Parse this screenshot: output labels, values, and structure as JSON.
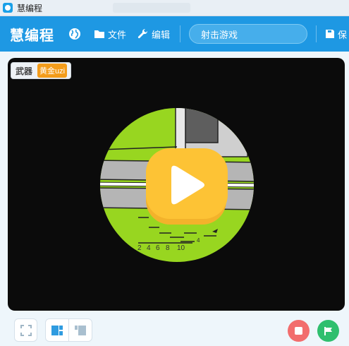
{
  "window": {
    "title": "慧编程"
  },
  "header": {
    "logo": "慧编程",
    "file_label": "文件",
    "edit_label": "编辑",
    "project_name": "射击游戏",
    "save_label": "保"
  },
  "stage": {
    "variable": {
      "name": "武器",
      "value": "黄金uzi"
    },
    "scope_marks": [
      "2",
      "4",
      "6",
      "8",
      "10",
      "4"
    ]
  },
  "colors": {
    "header": "#1e98e3",
    "accent_orange": "#f39c1a",
    "scope_green": "#98d620",
    "play_yellow": "#fdc335",
    "stop_red": "#f26d6d",
    "go_green": "#2fbf6e"
  },
  "icons": {
    "app": "mblock-icon",
    "language": "globe-icon",
    "file": "folder-icon",
    "edit": "wrench-icon",
    "save": "save-icon",
    "play": "play-icon",
    "fullscreen": "fullscreen-icon",
    "layout_large": "large-stage-layout-icon",
    "layout_small": "small-stage-layout-icon",
    "stop": "stop-icon",
    "green_flag": "green-flag-icon"
  }
}
